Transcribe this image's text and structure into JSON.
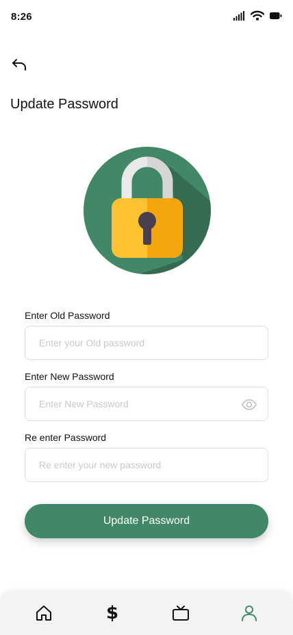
{
  "status_bar": {
    "time": "8:26",
    "icons": [
      "signal-icon",
      "wifi-icon",
      "battery-icon"
    ]
  },
  "header": {
    "back_icon": "back-arrow-icon",
    "title": "Update Password"
  },
  "hero": {
    "icon": "padlock-icon",
    "colors": {
      "circle": "#428866",
      "shadow": "#356b50",
      "lock_body": "#ffc233",
      "lock_body_shade": "#f5a60d",
      "shackle": "#e9e9e9",
      "keyhole": "#4a3f4e"
    }
  },
  "form": {
    "old_password": {
      "label": "Enter Old Password",
      "placeholder": "Enter your Old password",
      "value": ""
    },
    "new_password": {
      "label": "Enter New Password",
      "placeholder": "Enter New Password",
      "value": "",
      "toggle_icon": "eye-icon"
    },
    "confirm_password": {
      "label": "Re enter Password",
      "placeholder": "Re enter your new password",
      "value": ""
    },
    "submit_label": "Update Password"
  },
  "bottom_nav": {
    "items": [
      {
        "icon": "home-icon"
      },
      {
        "icon": "dollar-icon",
        "glyph": "$"
      },
      {
        "icon": "tv-icon"
      },
      {
        "icon": "profile-icon",
        "active": true
      }
    ],
    "active_color": "#428866"
  },
  "colors": {
    "accent": "#428866",
    "input_border": "#dedede",
    "placeholder": "#c8c8c8",
    "nav_background": "#f3f3f3"
  }
}
